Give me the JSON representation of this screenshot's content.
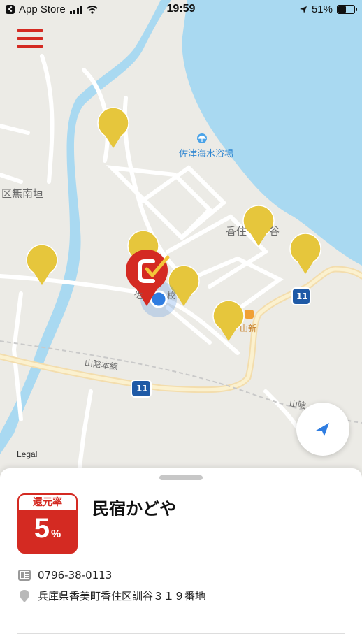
{
  "status_bar": {
    "back_app": "App Store",
    "time": "19:59",
    "battery": "51%",
    "battery_level": 0.51
  },
  "map": {
    "labels": {
      "beach": "佐津海水浴場",
      "district": "区無南垣",
      "area": "香住",
      "area_suffix": "谷",
      "railway": "山陰本線",
      "railway_right": "山陰",
      "route_a": "11",
      "route_b": "11",
      "shop": "山新",
      "school_prefix": "佐",
      "school_suffix": "校"
    },
    "legal": "Legal"
  },
  "sheet": {
    "badge_label": "還元率",
    "rate_value": "5",
    "rate_unit": "%",
    "shop_name": "民宿かどや",
    "phone": "0796-38-0113",
    "address": "兵庫県香美町香住区訓谷３１９番地"
  },
  "colors": {
    "accent": "#d42a22",
    "pin": "#e6c63c",
    "water": "#a9d9f1",
    "land": "#ecebe6",
    "user_dot": "#2f7de1"
  },
  "icons": {
    "menu": "hamburger-menu-icon",
    "locate": "location-arrow-icon",
    "phone": "phone-icon",
    "address": "location-pin-icon",
    "beach": "beach-umbrella-icon"
  }
}
